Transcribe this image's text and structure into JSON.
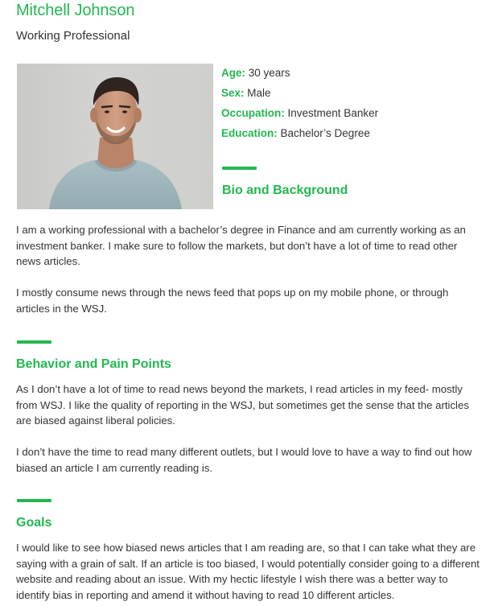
{
  "profile": {
    "name": "Mitchell Johnson",
    "subtitle": "Working Professional",
    "facts": [
      {
        "label": "Age:",
        "value": "30 years"
      },
      {
        "label": "Sex:",
        "value": "Male"
      },
      {
        "label": "Occupation:",
        "value": "Investment Banker"
      },
      {
        "label": "Education:",
        "value": "Bachelor’s Degree"
      }
    ]
  },
  "sections": {
    "bio": {
      "heading": "Bio and Background",
      "paragraphs": [
        "I am a working professional with a bachelor’s degree in Finance and am currently working as an investment banker. I make sure to follow the markets, but don’t have a lot of time to read other news articles.",
        "I mostly consume news through the news feed that pops up on my mobile phone, or through articles in the WSJ."
      ]
    },
    "behavior": {
      "heading": "Behavior and Pain Points",
      "paragraphs": [
        "As I don’t have a lot of time to read news beyond the markets, I read articles in my feed- mostly from WSJ. I like the quality of reporting in the WSJ, but sometimes get the sense that the articles are biased against liberal policies.",
        "I don’t have the time to read many different outlets, but I would love to have a way to find out how biased an article I am currently reading is."
      ]
    },
    "goals": {
      "heading": "Goals",
      "paragraphs": [
        "I would like to see how biased news articles that I am reading are, so that I can take what they are saying with a grain of salt. If an article is too biased, I would potentially consider going to a different website and reading about an issue. With my hectic lifestyle I wish there was a better way to identify bias in reporting and amend it without having to read 10 different articles."
      ]
    }
  }
}
